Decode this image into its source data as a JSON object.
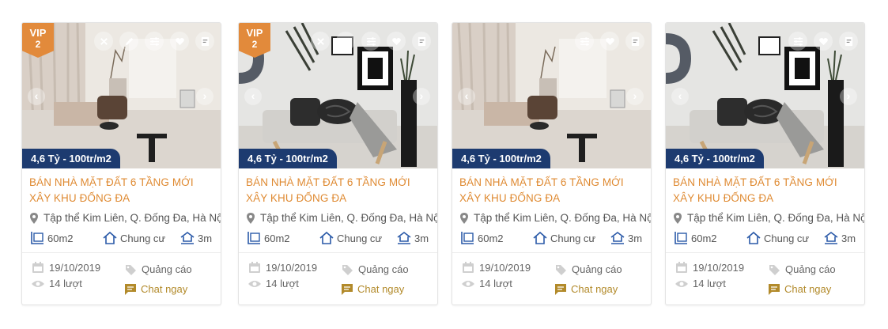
{
  "listings": [
    {
      "vip_label": "VIP",
      "vip_level": "2",
      "price": "4,6 Tỷ - 100tr/m2",
      "title": "BÁN NHÀ MẶT ĐẤT 6 TẦNG MỚI XÂY KHU ĐỐNG ĐA",
      "location": "Tập thể Kim Liên, Q. Đống Đa, Hà Nội",
      "area": "60m2",
      "type": "Chung cư",
      "frontage": "3m",
      "date": "19/10/2019",
      "views": "14 lượt",
      "ad_label": "Quảng cáo",
      "chat_label": "Chat ngay",
      "image": "room-warm"
    },
    {
      "vip_label": "VIP",
      "vip_level": "2",
      "price": "4,6 Tỷ - 100tr/m2",
      "title": "BÁN NHÀ MẶT ĐẤT 6 TẦNG MỚI XÂY KHU ĐỐNG ĐA",
      "location": "Tập thể Kim Liên, Q. Đống Đa, Hà Nội",
      "area": "60m2",
      "type": "Chung cư",
      "frontage": "3m",
      "date": "19/10/2019",
      "views": "14 lượt",
      "ad_label": "Quảng cáo",
      "chat_label": "Chat ngay",
      "image": "sofa-gallery"
    },
    {
      "price": "4,6 Tỷ - 100tr/m2",
      "title": "BÁN NHÀ MẶT ĐẤT 6 TẦNG MỚI XÂY KHU ĐỐNG ĐA",
      "location": "Tập thể Kim Liên, Q. Đống Đa, Hà Nội",
      "area": "60m2",
      "type": "Chung cư",
      "frontage": "3m",
      "date": "19/10/2019",
      "views": "14 lượt",
      "ad_label": "Quảng cáo",
      "chat_label": "Chat ngay",
      "image": "room-warm"
    },
    {
      "price": "4,6 Tỷ - 100tr/m2",
      "title": "BÁN NHÀ MẶT ĐẤT 6 TẦNG MỚI XÂY KHU ĐỐNG ĐA",
      "location": "Tập thể Kim Liên, Q. Đống Đa, Hà Nội",
      "area": "60m2",
      "type": "Chung cư",
      "frontage": "3m",
      "date": "19/10/2019",
      "views": "14 lượt",
      "ad_label": "Quảng cáo",
      "chat_label": "Chat ngay",
      "image": "sofa-gallery"
    }
  ],
  "card_tools": [
    "close-icon",
    "edit-icon",
    "compare-icon",
    "heart-icon",
    "note-icon"
  ],
  "colors": {
    "vip": "#e28a3b",
    "price_bg": "#1d3b70",
    "title": "#df8a32",
    "chat": "#b28a2a"
  }
}
